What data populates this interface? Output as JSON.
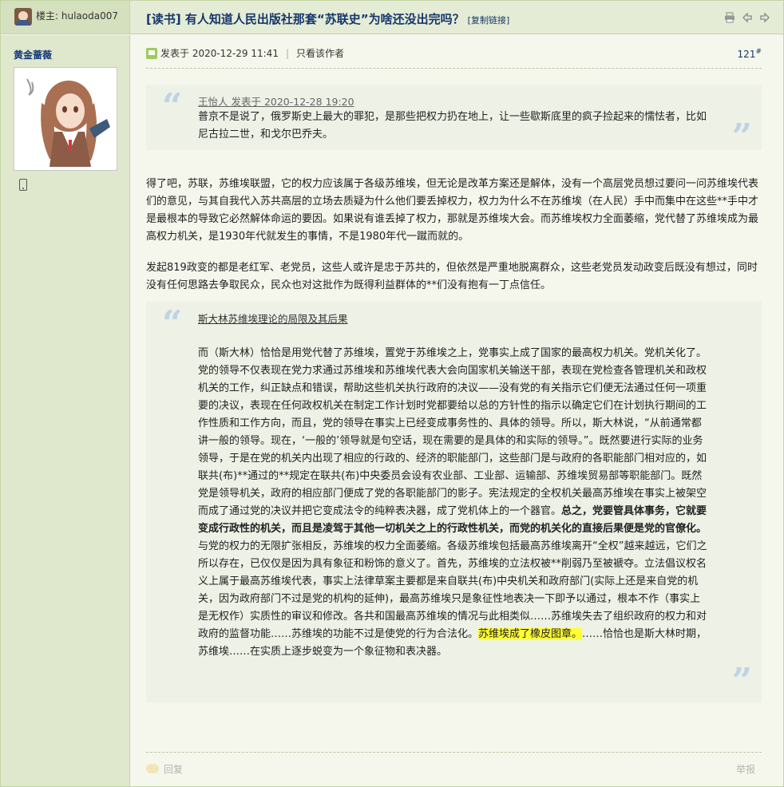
{
  "header": {
    "op_label": "楼主: hulaoda007",
    "title": "[读书] 有人知道人民出版社那套“苏联史”为啥还没出完吗？",
    "copy_link": "[复制链接]",
    "icons": [
      "print-icon",
      "prev-arrow-icon",
      "next-arrow-icon"
    ]
  },
  "sidebar": {
    "author": "黄金蔷薇",
    "device_icon": "mobile-icon"
  },
  "post": {
    "posted_at": "发表于 2020-12-29 11:41",
    "only_author": "只看该作者",
    "floor": "121",
    "floor_suffix": "#",
    "quote1": {
      "by": "王怡人 发表于 2020-12-28 19:20",
      "text": "普京不是说了，俄罗斯史上最大的罪犯，是那些把权力扔在地上，让一些歇斯底里的疯子捡起来的懦怯者，比如尼古拉二世，和戈尔巴乔夫。"
    },
    "para1": "得了吧，苏联，苏维埃联盟，它的权力应该属于各级苏维埃，但无论是改革方案还是解体，没有一个高层党员想过要问一问苏维埃代表们的意见，与其自我代入苏共高层的立场去质疑为什么他们要丢掉权力，权力为什么不在苏维埃（在人民）手中而集中在这些**手中才是最根本的导致它必然解体命运的要因。如果说有谁丢掉了权力，那就是苏维埃大会。而苏维埃权力全面萎缩，党代替了苏维埃成为最高权力机关，是1930年代就发生的事情，不是1980年代一蹴而就的。",
    "para2": "发起819政变的都是老红军、老党员，这些人或许是忠于苏共的，但依然是严重地脱离群众，这些老党员发动政变后既没有想过，同时没有任何思路去争取民众，民众也对这批作为既得利益群体的**们没有抱有一丁点信任。",
    "quote2": {
      "title": "斯大林苏维埃理论的局限及其后果",
      "part1": "而（斯大林）恰恰是用党代替了苏维埃，置党于苏维埃之上，党事实上成了国家的最高权力机关。党机关化了。党的领导不仅表现在党力求通过苏维埃和苏维埃代表大会向国家机关输送干部，表现在党检查各管理机关和政权机关的工作，纠正缺点和错误，帮助这些机关执行政府的决议——没有党的有关指示它们便无法通过任何一项重要的决议，表现在任何政权机关在制定工作计划时党都要给以总的方针性的指示以确定它们在计划执行期间的工作性质和工作方向，而且，党的领导在事实上已经变成事务性的、具体的领导。所以，斯大林说，“从前通常都讲一般的领导。现在，‘一般的’领导就是句空话，现在需要的是具体的和实际的领导。”。既然要进行实际的业务领导，于是在党的机关内出现了相应的行政的、经济的职能部门，这些部门是与政府的各职能部门相对应的，如联共(布)**通过的**规定在联共(布)中央委员会设有农业部、工业部、运输部、苏维埃贸易部等职能部门。既然党是领导机关，政府的相应部门便成了党的各职能部门的影子。宪法规定的全权机关最高苏维埃在事实上被架空而成了通过党的决议并把它变成法令的纯粹表决器，成了党机体上的一个器官。",
      "bold": "总之，党要管具体事务，它就要变成行政性的机关，而且是凌驾于其他一切机关之上的行政性机关，而党的机关化的直接后果便是党的官僚化。",
      "part2": "与党的权力的无限扩张相反，苏维埃的权力全面萎缩。各级苏维埃包括最高苏维埃离开“全权”越来越远，它们之所以存在，已仅仅是因为具有象征和粉饰的意义了。首先，苏维埃的立法权被**削弱乃至被褫夺。立法倡议权名义上属于最高苏维埃代表，事实上法律草案主要都是来自联共(布)中央机关和政府部门(实际上还是来自党的机关，因为政府部门不过是党的机构的延伸)，最高苏维埃只是象征性地表决一下即予以通过，根本不作（事实上是无权作）实质性的审议和修改。各共和国最高苏维埃的情况与此相类似……苏维埃失去了组织政府的权力和对政府的监督功能……苏维埃的功能不过是使党的行为合法化。",
      "highlight": "苏维埃成了橡皮图章。",
      "part3": "……恰恰也是斯大林时期，苏维埃……在实质上逐步蜕变为一个象征物和表决器。"
    }
  },
  "footer": {
    "reply": "回复",
    "report": "举报"
  }
}
